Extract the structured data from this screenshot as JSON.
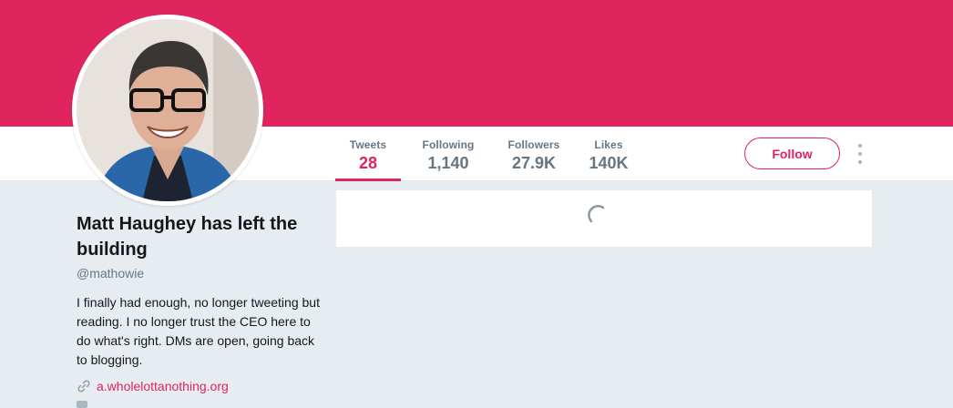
{
  "colors": {
    "accent": "#e0245e",
    "background": "#e6ecf0",
    "muted": "#657786"
  },
  "stats": [
    {
      "label": "Tweets",
      "value": "28",
      "active": true
    },
    {
      "label": "Following",
      "value": "1,140"
    },
    {
      "label": "Followers",
      "value": "27.9K"
    },
    {
      "label": "Likes",
      "value": "140K"
    }
  ],
  "actions": {
    "follow_label": "Follow",
    "more_icon": "more-vertical-icon"
  },
  "profile": {
    "name": "Matt Haughey has left the building",
    "handle": "@mathowie",
    "bio": "I finally had enough, no longer tweeting but reading. I no longer trust the CEO here to do what's right. DMs are open, going back to blogging.",
    "website": "a.wholelottanothing.org",
    "website_icon": "link-icon"
  },
  "timeline": {
    "loading_icon": "spinner-icon"
  }
}
